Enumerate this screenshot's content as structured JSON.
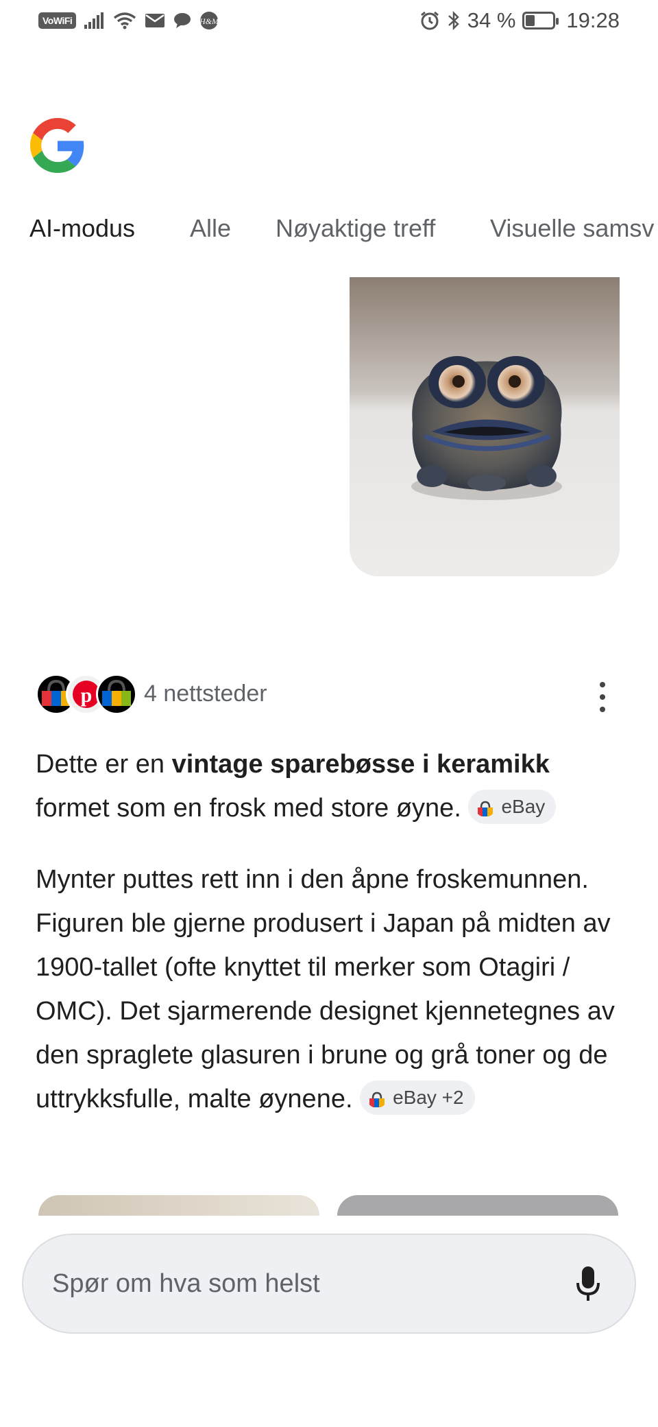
{
  "status_bar": {
    "vowifi": "VoWiFi",
    "battery_text": "34 %",
    "battery_level": 0.34,
    "time": "19:28"
  },
  "tabs": [
    "AI-modus",
    "Alle",
    "Nøyaktige treff",
    "Visuelle samsv"
  ],
  "sources": {
    "label": "4 nettsteder",
    "favicons": [
      "ebay-icon",
      "pinterest-icon",
      "ebay-icon"
    ]
  },
  "answer": {
    "p1": {
      "before": "Dette er en ",
      "bold": "vintage sparebøsse i keramikk",
      "after": " formet som en frosk med store øyne.",
      "chip": "eBay"
    },
    "p2": {
      "text": "Mynter puttes rett inn i den åpne froskemunnen. Figuren ble gjerne produsert i Japan på midten av 1900-tallet (ofte knyttet til merker som Otagiri / OMC). Det sjarmerende designet kjennetegnes av den spraglete glasuren i brune og grå toner og de uttrykksfulle, malte øynene.",
      "chip": "eBay +2"
    }
  },
  "search": {
    "placeholder": "Spør om hva som helst"
  },
  "colors": {
    "google_blue": "#4285F4",
    "google_red": "#EA4335",
    "google_yellow": "#FBBC05",
    "google_green": "#34A853",
    "pinterest": "#E60023"
  }
}
